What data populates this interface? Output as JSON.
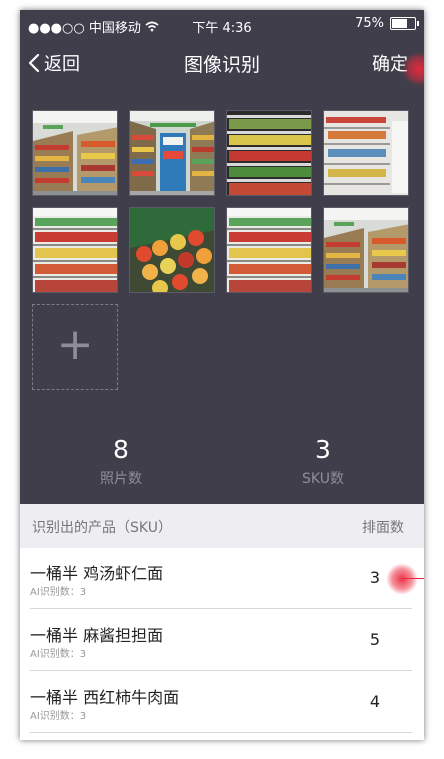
{
  "status_bar": {
    "carrier": "●●●○○ 中国移动",
    "time": "下午 4:36",
    "battery": "75%",
    "battery_level": 0.75
  },
  "nav": {
    "back_label": "返回",
    "title": "图像识别",
    "confirm_label": "确定"
  },
  "photos": [
    {
      "scene": "store-aisle"
    },
    {
      "scene": "store-aisle-center"
    },
    {
      "scene": "shelf-close"
    },
    {
      "scene": "shelf-sparse"
    },
    {
      "scene": "shelf-front"
    },
    {
      "scene": "shelf-produce"
    },
    {
      "scene": "shelf-front"
    },
    {
      "scene": "store-aisle"
    }
  ],
  "add_photo_symbol": "+",
  "stats": {
    "photo_count": "8",
    "photo_count_label": "照片数",
    "sku_count": "3",
    "sku_count_label": "SKU数"
  },
  "list": {
    "header_left": "识别出的产品（SKU）",
    "header_right": "排面数",
    "items": [
      {
        "name": "一桶半 鸡汤虾仁面",
        "ai_label": "AI识别数：3",
        "count": "3"
      },
      {
        "name": "一桶半 麻酱担担面",
        "ai_label": "AI识别数：3",
        "count": "5"
      },
      {
        "name": "一桶半 西红柿牛肉面",
        "ai_label": "AI识别数：3",
        "count": "4"
      }
    ]
  },
  "colors": {
    "background": "#413e4b",
    "touch_indicator": "#eb283c",
    "muted_text": "#8f8c9b"
  }
}
